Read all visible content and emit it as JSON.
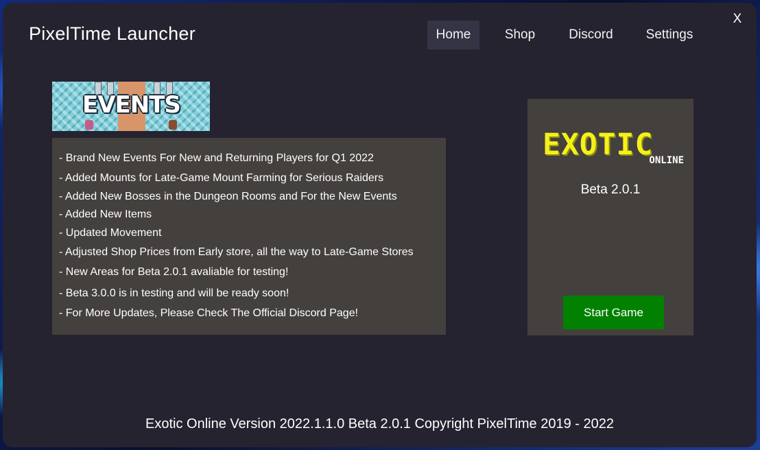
{
  "app": {
    "title": "PixelTime Launcher",
    "close_label": "X"
  },
  "nav": {
    "items": [
      {
        "label": "Home",
        "active": true
      },
      {
        "label": "Shop",
        "active": false
      },
      {
        "label": "Discord",
        "active": false
      },
      {
        "label": "Settings",
        "active": false
      }
    ]
  },
  "events": {
    "banner_text": "EVENTS",
    "notes": [
      "- Brand New Events For New and Returning Players for Q1 2022",
      "- Added Mounts for Late-Game Mount Farming for Serious Raiders",
      "- Added New Bosses in the Dungeon Rooms and For the New Events",
      "- Added New Items",
      "- Updated Movement",
      "- Adjusted Shop Prices from Early store, all the way to Late-Game Stores",
      "- New Areas for Beta 2.0.1 avaliable for testing!",
      "- Beta 3.0.0 is in testing and will be ready soon!",
      "- For More Updates, Please Check The Official Discord Page!"
    ]
  },
  "game": {
    "logo_main": "EXOTIC",
    "logo_sub": "ONLINE",
    "version": "Beta 2.0.1",
    "start_label": "Start Game"
  },
  "footer": {
    "text": "Exotic Online Version 2022.1.1.0 Beta 2.0.1 Copyright PixelTime 2019 - 2022"
  },
  "colors": {
    "window_bg": "#25232f",
    "panel_bg": "#44403d",
    "nav_active_bg": "#353445",
    "start_button": "#028100",
    "logo_yellow": "#f4f01c"
  }
}
